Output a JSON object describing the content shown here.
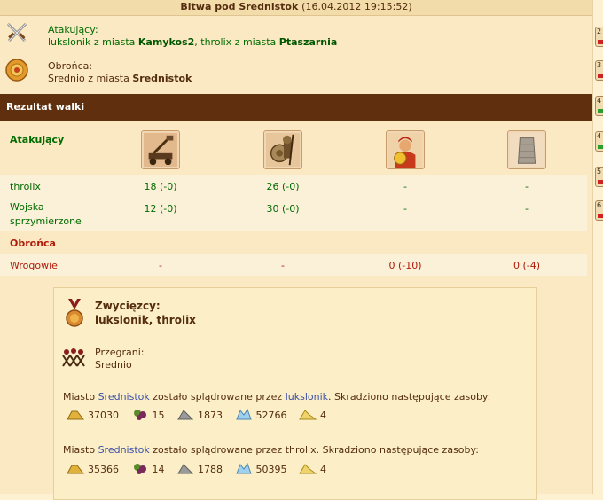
{
  "window": {
    "title": "Bitwa pod Srednistok",
    "date": "(16.04.2012 19:15:52)"
  },
  "attackers": {
    "label": "Atakujący:",
    "player1": "lukslonik",
    "from1": "z miasta",
    "town1": "Kamykos2",
    "sep": ",",
    "player2": "throlix",
    "from2": "z miasta",
    "town2": "Ptaszarnia"
  },
  "defender": {
    "label": "Obrońca:",
    "player": "Srednio",
    "from": "z miasta",
    "town": "Srednistok"
  },
  "result": {
    "header": "Rezultat walki",
    "attacker_section": "Atakujący",
    "defender_section": "Obrońca",
    "units": [
      "catapult",
      "hoplite",
      "warrior",
      "wall"
    ],
    "rows": [
      {
        "name": "throlix",
        "values": [
          "18 (-0)",
          "26 (-0)",
          "-",
          "-"
        ]
      },
      {
        "name": "Wojska sprzymierzone",
        "values": [
          "12 (-0)",
          "30 (-0)",
          "-",
          "-"
        ]
      }
    ],
    "enemy_row": {
      "name": "Wrogowie",
      "values": [
        "-",
        "-",
        "0 (-10)",
        "0 (-4)"
      ]
    }
  },
  "summary": {
    "winners_label": "Zwycięzcy:",
    "winners": "lukslonik, throlix",
    "losers_label": "Przegrani:",
    "losers": "Srednio",
    "plunder": [
      {
        "prefix": "Miasto",
        "town": "Srednistok",
        "mid": "zostało splądrowane przez",
        "player": "lukslonik",
        "suffix": ". Skradziono następujące zasoby:",
        "resources": [
          "37030",
          "15",
          "1873",
          "52766",
          "4"
        ]
      },
      {
        "prefix": "Miasto",
        "town": "Srednistok",
        "mid": "zostało splądrowane przez",
        "player": "throlix",
        "suffix": ". Skradziono następujące zasoby:",
        "resources": [
          "35366",
          "14",
          "1788",
          "50395",
          "4"
        ]
      }
    ]
  },
  "side_tabs": [
    "2",
    "3",
    "4",
    "4",
    "5",
    "6"
  ]
}
